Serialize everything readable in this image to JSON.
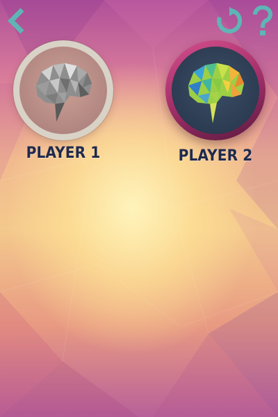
{
  "players": [
    {
      "label": "PLAYER 1",
      "avatar": "grayscale-brain-icon",
      "selected": false
    },
    {
      "label": "PLAYER 2",
      "avatar": "colorful-brain-icon",
      "selected": true
    }
  ],
  "toolbar": {
    "back_icon": "chevron-left-icon",
    "refresh_icon": "refresh-icon",
    "help_icon": "question-mark-icon"
  },
  "colors": {
    "icon_teal": "#5fb5b5",
    "label_navy": "#1f2a4d",
    "selected_ring": "#c23b7c"
  }
}
